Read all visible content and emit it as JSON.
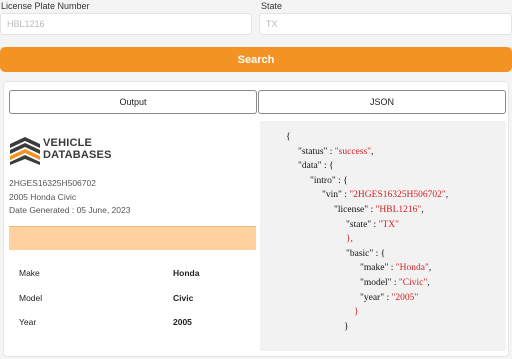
{
  "form": {
    "license_label": "License Plate Number",
    "license_placeholder": "HBL1216",
    "state_label": "State",
    "state_placeholder": "TX",
    "search_label": "Search"
  },
  "tabs": {
    "output": "Output",
    "json": "JSON"
  },
  "brand": {
    "line1": "VEHICLE",
    "line2": "DATABASES"
  },
  "summary": {
    "vin": "2HGES16325H506702",
    "vehicle": "2005 Honda Civic",
    "date_generated": "Date Generated : 05 June, 2023"
  },
  "specs": [
    {
      "label": "Make",
      "value": "Honda"
    },
    {
      "label": "Model",
      "value": "Civic"
    },
    {
      "label": "Year",
      "value": "2005"
    }
  ],
  "json_lines": [
    {
      "t": "{"
    },
    {
      "k": "\"status\"",
      "s": "\"success\"",
      "tail": ","
    },
    {
      "k": "\"data\"",
      "tail": " : {"
    },
    {
      "k": "\"intro\"",
      "tail": " : {"
    },
    {
      "k": "\"vin\"",
      "s": "\"2HGES16325H506702\"",
      "tail": ","
    },
    {
      "k": "\"license\"",
      "s": "\"HBL1216\"",
      "tail": ","
    },
    {
      "k": "\"state\"",
      "s": "\"TX\""
    },
    {
      "red": "},"
    },
    {
      "k": "\"basic\"",
      "tail": " : {"
    },
    {
      "k": "\"make\"",
      "s": "\"Honda\"",
      "tail": ","
    },
    {
      "k": "\"model\"",
      "s": "\"Civic\"",
      "tail": ","
    },
    {
      "k": "\"year\"",
      "s": "\"2005\""
    },
    {
      "red": "}"
    },
    {
      "t": "}"
    }
  ],
  "colors": {
    "accent": "#f39324",
    "highlight": "#fed19f",
    "json_string": "#d21f1f"
  }
}
